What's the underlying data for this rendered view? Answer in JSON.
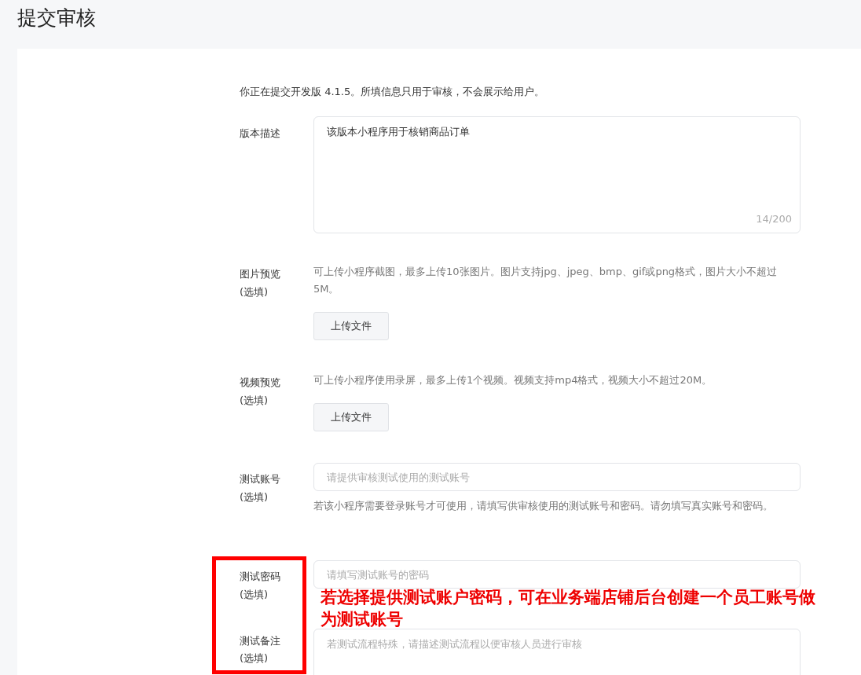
{
  "page": {
    "title": "提交审核"
  },
  "intro": "你正在提交开发版 4.1.5。所填信息只用于审核，不会展示给用户。",
  "fields": [
    {
      "kind": "textarea",
      "label": "版本描述",
      "value": "该版本小程序用于核销商品订单",
      "counter": "14/200"
    },
    {
      "kind": "upload",
      "label": "图片预览",
      "optional": "(选填)",
      "hint": "可上传小程序截图，最多上传10张图片。图片支持jpg、jpeg、bmp、gif或png格式，图片大小不超过5M。",
      "button": "上传文件"
    },
    {
      "kind": "upload",
      "label": "视频预览",
      "optional": "(选填)",
      "hint": "可上传小程序使用录屏，最多上传1个视频。视频支持mp4格式，视频大小不超过20M。",
      "button": "上传文件"
    },
    {
      "kind": "input",
      "label": "测试账号",
      "optional": "(选填)",
      "placeholder": "请提供审核测试使用的测试账号",
      "hint": "若该小程序需要登录账号才可使用，请填写供审核使用的测试账号和密码。请勿填写真实账号和密码。"
    },
    {
      "kind": "input",
      "label": "测试密码",
      "optional": "(选填)",
      "placeholder": "请填写测试账号的密码"
    },
    {
      "kind": "textarea",
      "label": "测试备注",
      "optional": "(选填)",
      "placeholder": "若测试流程特殊，请描述测试流程以便审核人员进行审核"
    }
  ],
  "annotation": {
    "text": "若选择提供测试账户密码，可在业务端店铺后台创建一个员工账号做为测试账号"
  }
}
